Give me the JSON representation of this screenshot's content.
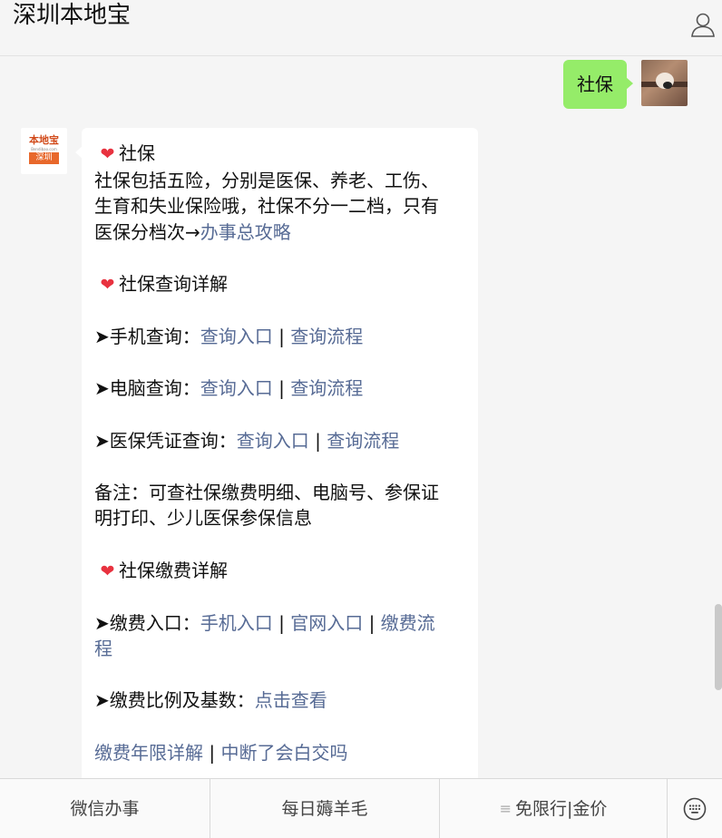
{
  "header": {
    "title": "深圳本地宝"
  },
  "user_message": {
    "text": "社保"
  },
  "bot": {
    "avatar": {
      "top": "本地宝",
      "url": "Bendibao.com",
      "bar": "深圳"
    },
    "title": "社保",
    "intro_1": "社保包括五险，分别是医保、养老、工伤、",
    "intro_2": "生育和失业保险哦，社保不分一二档，只有",
    "intro_3": "医保分档次→",
    "intro_link": "办事总攻略",
    "section_query": "社保查询详解",
    "mobile_label": "➤手机查询：",
    "computer_label": "➤电脑查询：",
    "medical_label": "➤医保凭证查询：",
    "entry_link": "查询入口",
    "flow_link": "查询流程",
    "separator": " | ",
    "note_1": "备注：可查社保缴费明细、电脑号、参保证",
    "note_2": "明打印、少儿医保参保信息",
    "section_pay": "社保缴费详解",
    "pay_label": "➤缴费入口：",
    "pay_mobile_link": "手机入口",
    "pay_web_link": "官网入口",
    "pay_flow_link_1": "缴费流",
    "pay_flow_link_2": "程",
    "ratio_label": "➤缴费比例及基数：",
    "ratio_link": "点击查看",
    "years_link": "缴费年限详解",
    "interrupt_link": "中断了会白交吗"
  },
  "tabbar": {
    "tab1": "微信办事",
    "tab2": "每日薅羊毛",
    "tab3_icon": "≡",
    "tab3": "免限行|金价"
  },
  "icons": {
    "profile": "person-icon",
    "heart": "heart-icon",
    "keyboard": "keyboard-icon"
  },
  "colors": {
    "user_bubble": "#95ec69",
    "link": "#576b95",
    "heart": "#e8323f"
  }
}
